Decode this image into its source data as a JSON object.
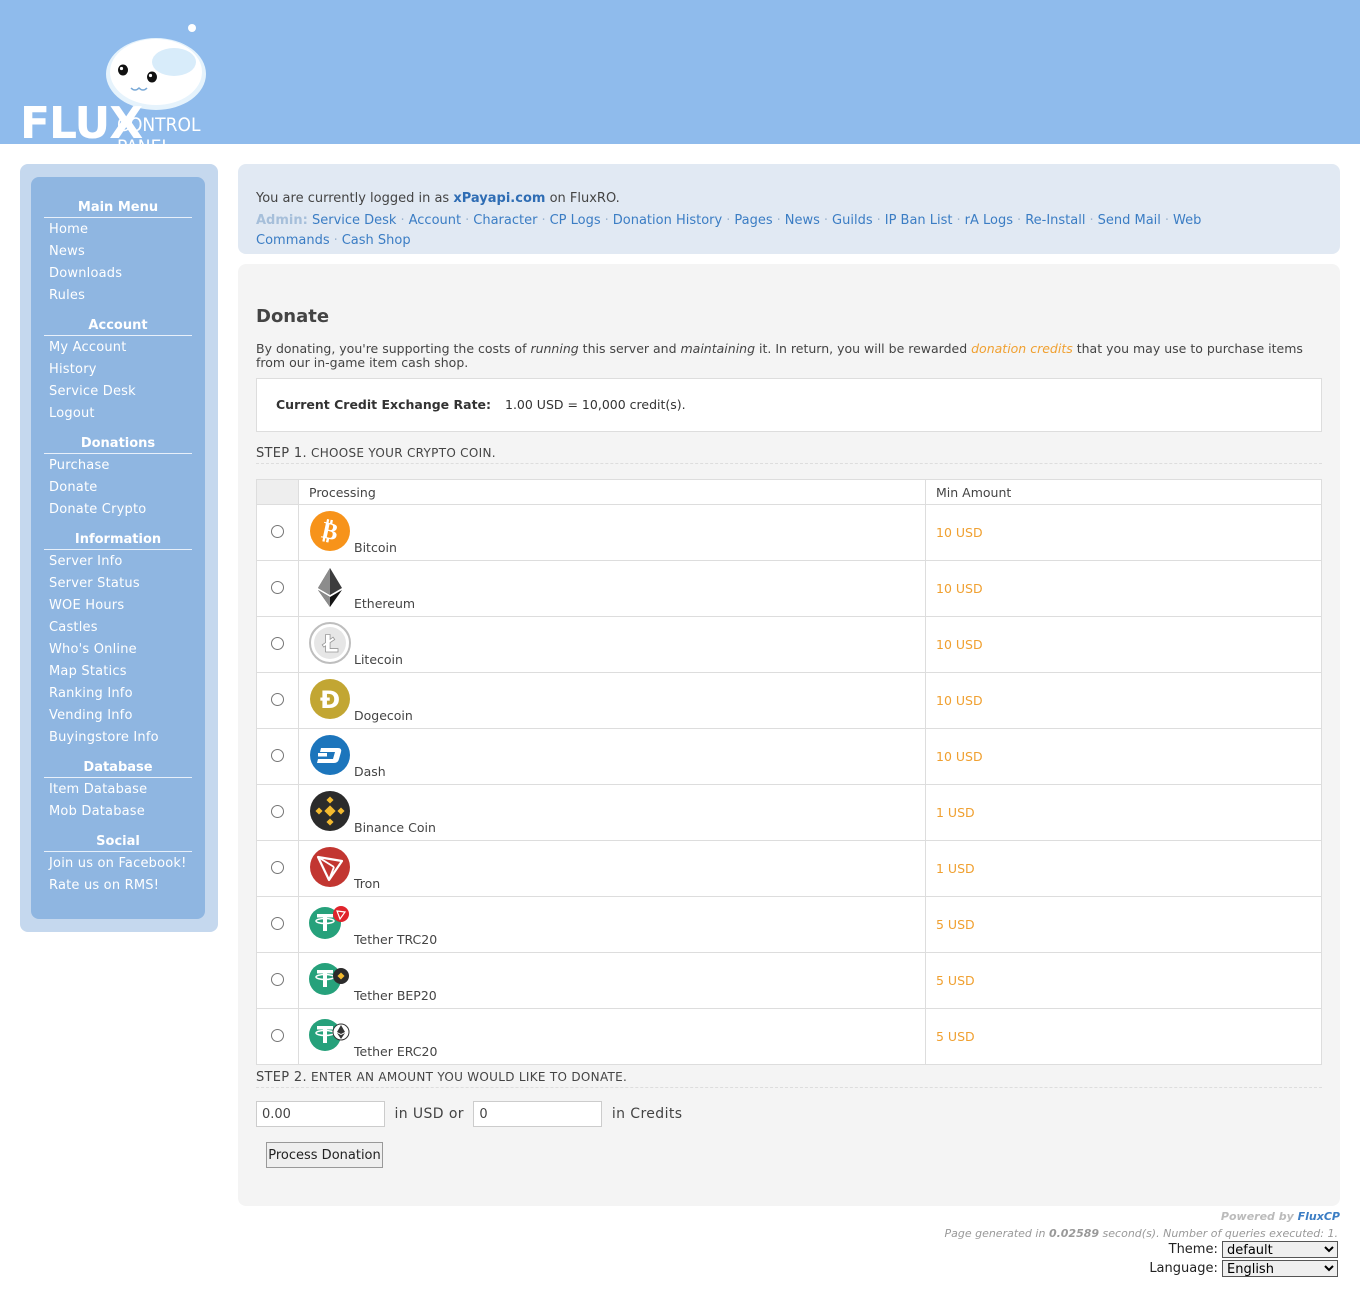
{
  "header": {
    "logo_word": "FLUX",
    "logo_subtitle": "CONTROL PANEL"
  },
  "sidebar": {
    "groups": [
      {
        "title": "Main Menu",
        "items": [
          "Home",
          "News",
          "Downloads",
          "Rules"
        ]
      },
      {
        "title": "Account",
        "items": [
          "My Account",
          "History",
          "Service Desk",
          "Logout"
        ]
      },
      {
        "title": "Donations",
        "items": [
          "Purchase",
          "Donate",
          "Donate Crypto"
        ]
      },
      {
        "title": "Information",
        "items": [
          "Server Info",
          "Server Status",
          "WOE Hours",
          "Castles",
          "Who's Online",
          "Map Statics",
          "Ranking Info",
          "Vending Info",
          "Buyingstore Info"
        ]
      },
      {
        "title": "Database",
        "items": [
          "Item Database",
          "Mob Database"
        ]
      },
      {
        "title": "Social",
        "items": [
          "Join us on Facebook!",
          "Rate us on RMS!"
        ]
      }
    ]
  },
  "loginbar": {
    "prefix": "You are currently logged in as",
    "username": "xPayapi.com",
    "suffix": "on FluxRO.",
    "admin_label": "Admin:",
    "admin_links": [
      "Service Desk",
      "Account",
      "Character",
      "CP Logs",
      "Donation History",
      "Pages",
      "News",
      "Guilds",
      "IP Ban List",
      "rA Logs",
      "Re-Install",
      "Send Mail",
      "Web Commands",
      "Cash Shop"
    ]
  },
  "content": {
    "title": "Donate",
    "intro": {
      "p1": "By donating, you're supporting the costs of ",
      "running": "running",
      "p2": " this server and ",
      "maintaining": "maintaining",
      "p3": " it. In return, you will be rewarded ",
      "credits": "donation credits",
      "p4": " that you may use to purchase items from our in-game item cash shop."
    },
    "rate_label": "Current Credit Exchange Rate:",
    "rate_value": "1.00 USD = 10,000 credit(s).",
    "step1": {
      "step": "STEP 1.",
      "text": "CHOOSE YOUR CRYPTO COIN."
    },
    "table_headers": {
      "processing": "Processing",
      "min_amount": "Min Amount"
    },
    "coins": [
      {
        "name": "Bitcoin",
        "icon": "bitcoin-icon",
        "min": "10 USD",
        "color": "#f7931a"
      },
      {
        "name": "Ethereum",
        "icon": "ethereum-icon",
        "min": "10 USD",
        "color": "#3c3c3d"
      },
      {
        "name": "Litecoin",
        "icon": "litecoin-icon",
        "min": "10 USD",
        "color": "#bebebe"
      },
      {
        "name": "Dogecoin",
        "icon": "dogecoin-icon",
        "min": "10 USD",
        "color": "#c2a633"
      },
      {
        "name": "Dash",
        "icon": "dash-icon",
        "min": "10 USD",
        "color": "#1c75bc"
      },
      {
        "name": "Binance Coin",
        "icon": "binance-icon",
        "min": "1 USD",
        "color": "#f3ba2f"
      },
      {
        "name": "Tron",
        "icon": "tron-icon",
        "min": "1 USD",
        "color": "#c23631"
      },
      {
        "name": "Tether TRC20",
        "icon": "tether-trc20-icon",
        "min": "5 USD",
        "color": "#26a17b"
      },
      {
        "name": "Tether BEP20",
        "icon": "tether-bep20-icon",
        "min": "5 USD",
        "color": "#26a17b"
      },
      {
        "name": "Tether ERC20",
        "icon": "tether-erc20-icon",
        "min": "5 USD",
        "color": "#26a17b"
      }
    ],
    "step2": {
      "step": "STEP 2.",
      "text": "ENTER AN AMOUNT YOU WOULD LIKE TO DONATE."
    },
    "usd_value": "0.00",
    "usd_label": "in USD or",
    "credits_value": "0",
    "credits_label": "in Credits",
    "process_button": "Process Donation"
  },
  "footer": {
    "powered_by": "Powered by",
    "fluxcp": "FluxCP",
    "generated_prefix": "Page generated in",
    "generated_time": "0.02589",
    "generated_suffix": "second(s). Number of queries executed:",
    "queries": "1",
    "theme_label": "Theme:",
    "theme_value": "default",
    "language_label": "Language:",
    "language_value": "English"
  }
}
